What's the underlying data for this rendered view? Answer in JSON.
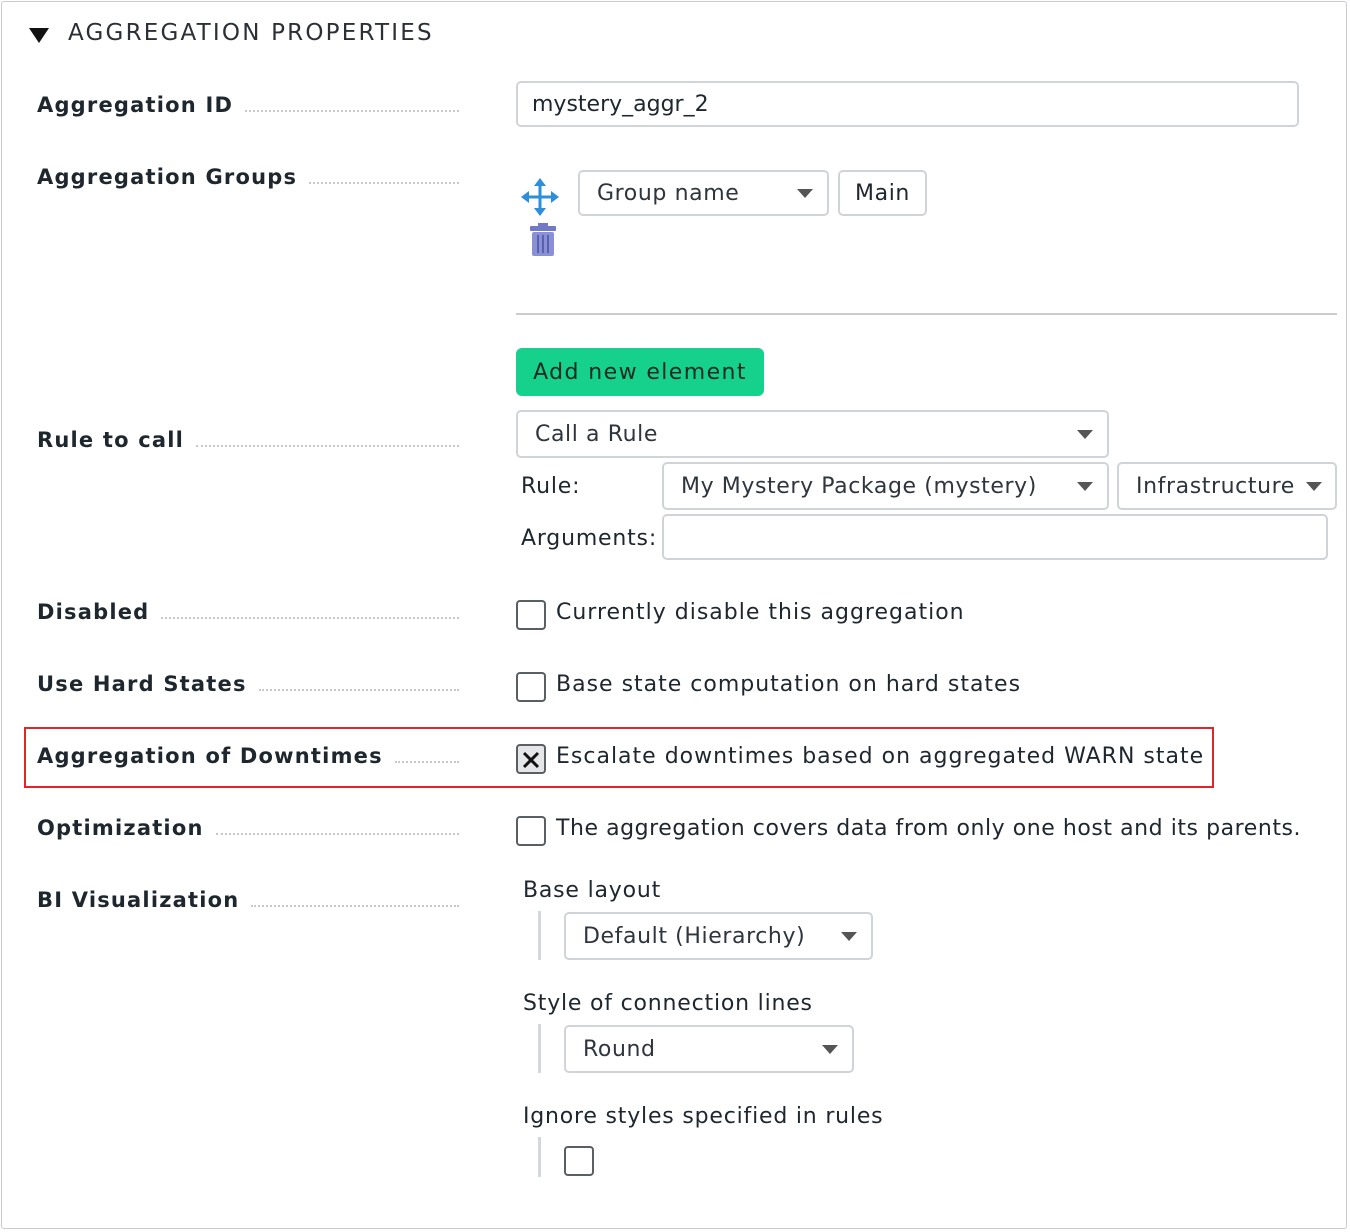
{
  "section": {
    "title": "AGGREGATION PROPERTIES"
  },
  "aggregation_id": {
    "label": "Aggregation ID",
    "value": "mystery_aggr_2"
  },
  "aggregation_groups": {
    "label": "Aggregation Groups",
    "group_select": "Group name",
    "group_value": "Main",
    "move_icon": "move-arrows-icon",
    "delete_icon": "trash-icon",
    "add_button": "Add new element"
  },
  "rule_to_call": {
    "label": "Rule to call",
    "mode_select": "Call a Rule",
    "rule_label": "Rule:",
    "rule_pack_select": "My Mystery Package (mystery)",
    "rule_select": "Infrastructure",
    "arguments_label": "Arguments:",
    "arguments_value": ""
  },
  "disabled": {
    "label": "Disabled",
    "checkbox_text": "Currently disable this aggregation",
    "checked": false
  },
  "hard_states": {
    "label": "Use Hard States",
    "checkbox_text": "Base state computation on hard states",
    "checked": false
  },
  "downtimes": {
    "label": "Aggregation of Downtimes",
    "checkbox_text": "Escalate downtimes based on aggregated WARN state",
    "checked": true
  },
  "optimization": {
    "label": "Optimization",
    "checkbox_text": "The aggregation covers data from only one host and its parents.",
    "checked": false
  },
  "bi_visualization": {
    "label": "BI Visualization",
    "base_layout_label": "Base layout",
    "base_layout_value": "Default (Hierarchy)",
    "line_style_label": "Style of connection lines",
    "line_style_value": "Round",
    "ignore_styles_label": "Ignore styles specified in rules",
    "ignore_styles_checked": false
  },
  "colors": {
    "accent_green": "#15d18c",
    "highlight_red": "#e0262a",
    "icon_blue": "#2d8ed9",
    "trash_purple": "#7279c7"
  }
}
